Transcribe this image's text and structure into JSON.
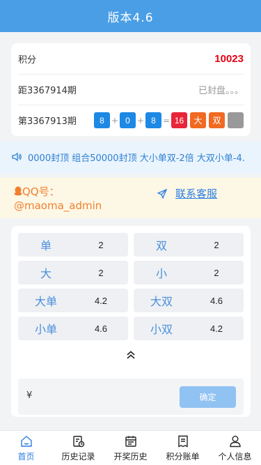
{
  "header": {
    "title": "版本4.6"
  },
  "info": {
    "score_label": "积分",
    "score_value": "10023",
    "next_period_label": "距3367914期",
    "next_period_status": "已封盘。。。",
    "last_period_label": "第3367913期",
    "result": {
      "n1": "8",
      "plus1": "+",
      "n2": "0",
      "plus2": "+",
      "n3": "8",
      "eq": "=",
      "sum": "16",
      "size": "大",
      "parity": "双",
      "extra": ""
    }
  },
  "notice": {
    "text": "0000封顶 组合50000封顶 大小单双-2倍 大双小单-4.",
    "icon": "speaker-icon"
  },
  "contact": {
    "qq_label": "QQ号：",
    "qq_value": "@maoma_admin",
    "link": "联系客服",
    "icons": [
      "qq-icon",
      "send-icon"
    ]
  },
  "bets": [
    {
      "name": "单",
      "odd": "2"
    },
    {
      "name": "双",
      "odd": "2"
    },
    {
      "name": "大",
      "odd": "2"
    },
    {
      "name": "小",
      "odd": "2"
    },
    {
      "name": "大单",
      "odd": "4.2"
    },
    {
      "name": "大双",
      "odd": "4.6"
    },
    {
      "name": "小单",
      "odd": "4.6"
    },
    {
      "name": "小双",
      "odd": "4.2"
    }
  ],
  "amount": {
    "currency": "¥",
    "confirm": "确定"
  },
  "tabs": [
    {
      "label": "首页",
      "icon": "home-icon",
      "active": true
    },
    {
      "label": "历史记录",
      "icon": "history-icon",
      "active": false
    },
    {
      "label": "开奖历史",
      "icon": "calendar-icon",
      "active": false
    },
    {
      "label": "积分账单",
      "icon": "bill-icon",
      "active": false
    },
    {
      "label": "个人信息",
      "icon": "user-icon",
      "active": false
    }
  ],
  "colors": {
    "primary": "#4a9ee6",
    "score": "#e60012",
    "ball_blue": "#1e88e5",
    "ball_red": "#e8253a",
    "ball_orange": "#f06a22",
    "ball_gray": "#999999"
  }
}
